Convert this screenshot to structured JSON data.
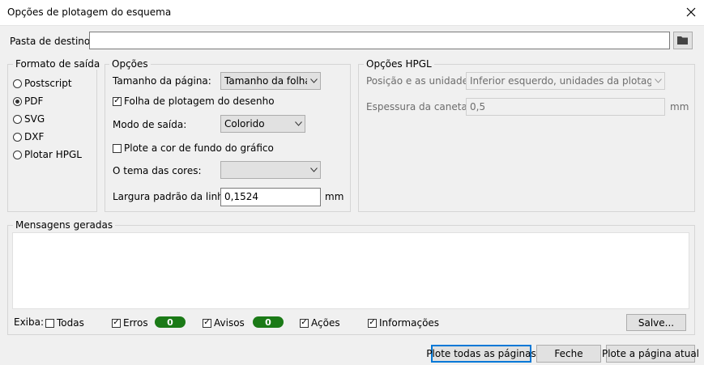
{
  "window": {
    "title": "Opções de plotagem do esquema"
  },
  "destination": {
    "label": "Pasta de destino:",
    "value": ""
  },
  "output_format": {
    "label": "Formato de saída",
    "options": [
      "Postscript",
      "PDF",
      "SVG",
      "DXF",
      "Plotar HPGL"
    ],
    "selected": "PDF"
  },
  "options": {
    "label": "Opções",
    "page_size_label": "Tamanho da página:",
    "page_size_value": "Tamanho da folha",
    "frame_label": "Folha de plotagem do desenho",
    "frame_checked": true,
    "mode_label": "Modo de saída:",
    "mode_value": "Colorido",
    "bg_label": "Plote a cor de fundo do gráfico",
    "bg_checked": false,
    "theme_label": "O tema das cores:",
    "theme_value": "",
    "line_width_label": "Largura padrão da linha:",
    "line_width_value": "0,1524",
    "line_width_unit": "mm"
  },
  "hpgl": {
    "label": "Opções HPGL",
    "position_label": "Posição e as unidades:",
    "position_value": "Inferior esquerdo, unidades da plotagem",
    "pen_label": "Espessura da caneta:",
    "pen_value": "0,5",
    "pen_unit": "mm"
  },
  "messages": {
    "label": "Mensagens geradas",
    "show_label": "Exiba:",
    "all_label": "Todas",
    "all_checked": false,
    "errors_label": "Erros",
    "errors_checked": true,
    "errors_count": "0",
    "warnings_label": "Avisos",
    "warnings_checked": true,
    "warnings_count": "0",
    "actions_label": "Ações",
    "actions_checked": true,
    "info_label": "Informações",
    "info_checked": true,
    "save_label": "Salve..."
  },
  "buttons": {
    "plot_all": "Plote todas as páginas",
    "close": "Feche",
    "plot_current": "Plote a página atual"
  },
  "colors": {
    "badge": "#1b7a17",
    "focus": "#0078d7"
  }
}
